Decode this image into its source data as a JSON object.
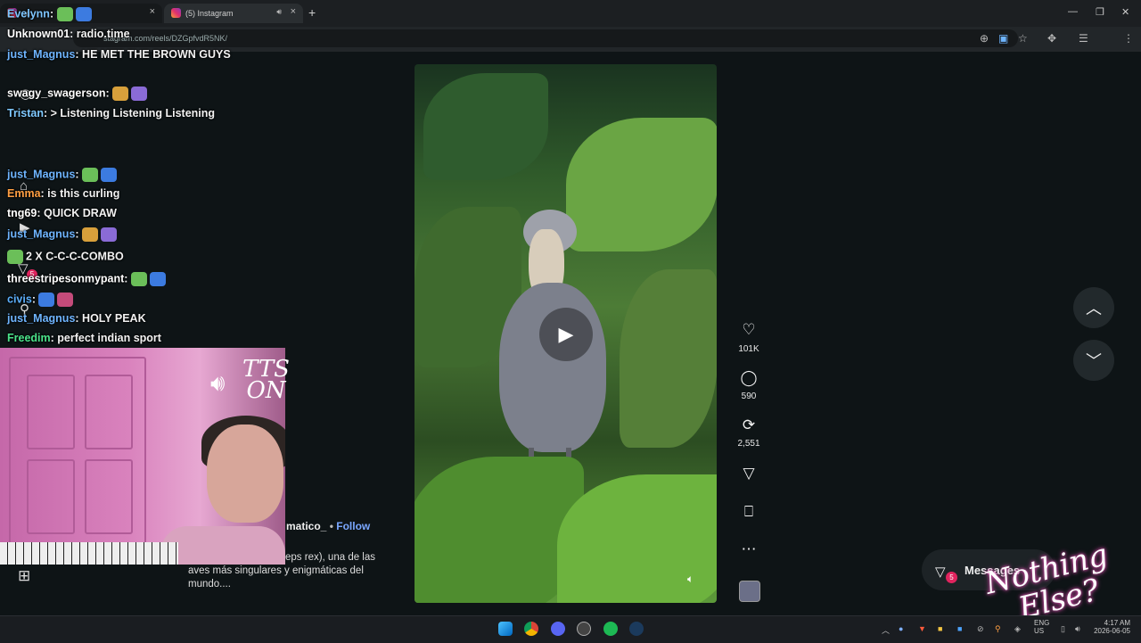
{
  "browser": {
    "tab1_title": "am",
    "tab2_title": "(5) Instagram",
    "url": "stagram.com/reels/DZGpfvdR5NK/",
    "new_tab": "+",
    "close": "×"
  },
  "chat": [
    {
      "user": "Evelynn",
      "text": "",
      "color": "#7ec6ff"
    },
    {
      "user": "Unknown01",
      "text": "radio.time",
      "color": "#ffffff"
    },
    {
      "user": "just_Magnus",
      "text": "HE MET THE BROWN GUYS",
      "color": "#6fb5ff"
    },
    {
      "user": "swagy_swagerson",
      "text": "",
      "color": "#ffffff"
    },
    {
      "user": "Tristan",
      "text": "> Listening Listening Listening",
      "color": "#7fc9ff"
    },
    {
      "user": "just_Magnus",
      "text": "",
      "color": "#6fb5ff"
    },
    {
      "user": "Emma",
      "text": "is this curling",
      "color": "#ff9f43"
    },
    {
      "user": "tng69",
      "text": "QUICK DRAW",
      "color": "#ffffff"
    },
    {
      "user": "just_Magnus",
      "text": "",
      "color": "#6fb5ff"
    },
    {
      "user": "",
      "text": "2 X C-C-C-COMBO",
      "color": "#ffffff"
    },
    {
      "user": "threestripesonmypant",
      "text": "",
      "color": "#ffffff"
    },
    {
      "user": "civis",
      "text": "",
      "color": "#5db1ff"
    },
    {
      "user": "just_Magnus",
      "text": "HOLY PEAK",
      "color": "#6fb5ff"
    },
    {
      "user": "Freedim",
      "text": "perfect indian sport",
      "color": "#4be38a"
    }
  ],
  "post": {
    "author": "matico_",
    "separator": "•",
    "follow": "Follow",
    "caption_fragment": "eps rex), una de las",
    "caption_line2": "aves más singulares y enigmáticas del",
    "caption_line3": "mundo...."
  },
  "actions": {
    "likes": "101K",
    "comments": "590",
    "reposts": "2,551"
  },
  "messages_label": "Messages",
  "messages_badge": "5",
  "notif_badge": "5",
  "overlay": {
    "tts_line1": "TTS",
    "tts_line2": "ON",
    "nothing_line1": "Nothing",
    "nothing_line2": "Else?"
  },
  "tray": {
    "lang": "ENG",
    "region": "US",
    "time": "4:17 AM",
    "date": "2026-06-05"
  },
  "colors": {
    "background": "#0e1416",
    "accent_follow": "#7aa7ff",
    "badge": "#e0245e"
  },
  "icons": {
    "like": "heart-icon",
    "comment": "comment-icon",
    "repost": "repost-icon",
    "share": "send-icon",
    "save": "bookmark-icon",
    "more": "more-icon"
  }
}
